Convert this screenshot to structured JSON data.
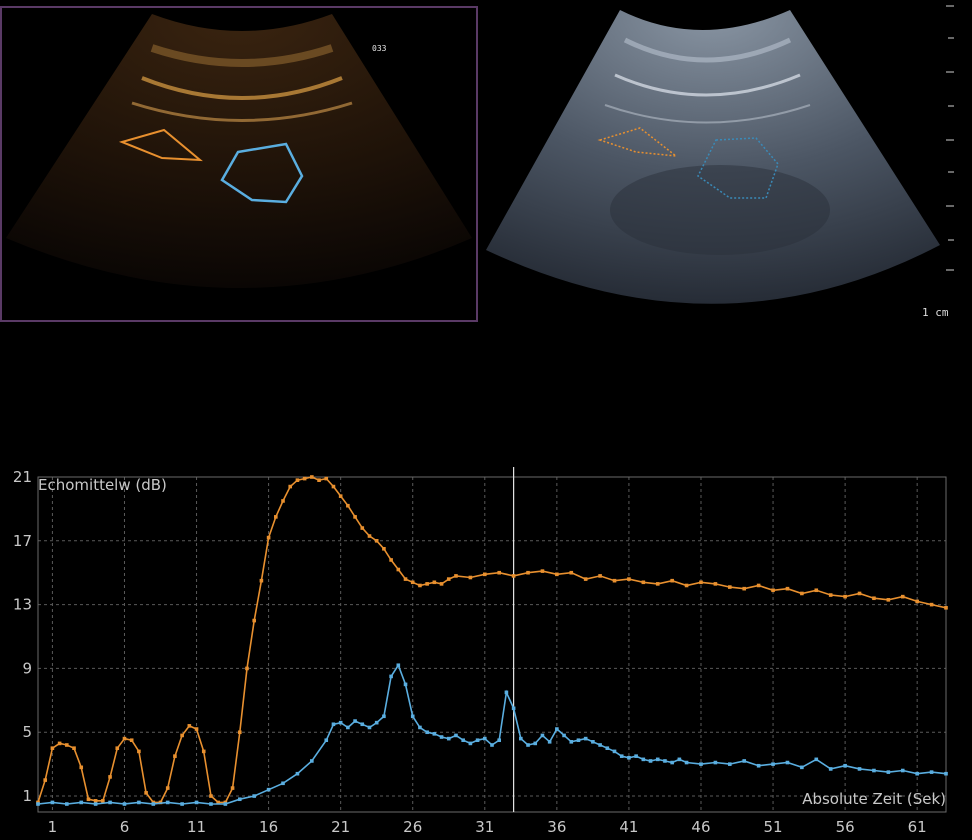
{
  "images": {
    "contrast_frame_label": "033",
    "scale_label": "1 cm"
  },
  "colors": {
    "orange": "#e8902f",
    "blue": "#5aaee0",
    "grid": "#5a5a5a",
    "text": "#c8c8c8"
  },
  "chart_data": {
    "type": "line",
    "ylabel": "Echomittelw (dB)",
    "xlabel": "Absolute Zeit (Sek)",
    "xlim": [
      0,
      63
    ],
    "ylim": [
      0,
      21
    ],
    "xticks": [
      1,
      6,
      11,
      16,
      21,
      26,
      31,
      36,
      41,
      46,
      51,
      56,
      61
    ],
    "yticks": [
      1,
      5,
      9,
      13,
      17,
      21
    ],
    "cursor_x": 33,
    "grid": true,
    "series": [
      {
        "color": "orange",
        "points": [
          [
            0,
            0.6
          ],
          [
            0.5,
            2
          ],
          [
            1,
            4
          ],
          [
            1.5,
            4.3
          ],
          [
            2,
            4.2
          ],
          [
            2.5,
            4
          ],
          [
            3,
            2.8
          ],
          [
            3.5,
            0.8
          ],
          [
            4,
            0.7
          ],
          [
            4.5,
            0.7
          ],
          [
            5,
            2.2
          ],
          [
            5.5,
            4
          ],
          [
            6,
            4.6
          ],
          [
            6.5,
            4.5
          ],
          [
            7,
            3.8
          ],
          [
            7.5,
            1.2
          ],
          [
            8,
            0.6
          ],
          [
            8.5,
            0.6
          ],
          [
            9,
            1.5
          ],
          [
            9.5,
            3.5
          ],
          [
            10,
            4.8
          ],
          [
            10.5,
            5.4
          ],
          [
            11,
            5.2
          ],
          [
            11.5,
            3.8
          ],
          [
            12,
            1
          ],
          [
            12.5,
            0.6
          ],
          [
            13,
            0.6
          ],
          [
            13.5,
            1.5
          ],
          [
            14,
            5
          ],
          [
            14.5,
            9
          ],
          [
            15,
            12
          ],
          [
            15.5,
            14.5
          ],
          [
            16,
            17.2
          ],
          [
            16.5,
            18.5
          ],
          [
            17,
            19.5
          ],
          [
            17.5,
            20.4
          ],
          [
            18,
            20.8
          ],
          [
            18.5,
            20.9
          ],
          [
            19,
            21
          ],
          [
            19.5,
            20.8
          ],
          [
            20,
            20.9
          ],
          [
            20.5,
            20.4
          ],
          [
            21,
            19.8
          ],
          [
            21.5,
            19.2
          ],
          [
            22,
            18.5
          ],
          [
            22.5,
            17.8
          ],
          [
            23,
            17.3
          ],
          [
            23.5,
            17
          ],
          [
            24,
            16.5
          ],
          [
            24.5,
            15.8
          ],
          [
            25,
            15.2
          ],
          [
            25.5,
            14.6
          ],
          [
            26,
            14.4
          ],
          [
            26.5,
            14.2
          ],
          [
            27,
            14.3
          ],
          [
            27.5,
            14.4
          ],
          [
            28,
            14.3
          ],
          [
            28.5,
            14.6
          ],
          [
            29,
            14.8
          ],
          [
            30,
            14.7
          ],
          [
            31,
            14.9
          ],
          [
            32,
            15
          ],
          [
            33,
            14.8
          ],
          [
            34,
            15
          ],
          [
            35,
            15.1
          ],
          [
            36,
            14.9
          ],
          [
            37,
            15
          ],
          [
            38,
            14.6
          ],
          [
            39,
            14.8
          ],
          [
            40,
            14.5
          ],
          [
            41,
            14.6
          ],
          [
            42,
            14.4
          ],
          [
            43,
            14.3
          ],
          [
            44,
            14.5
          ],
          [
            45,
            14.2
          ],
          [
            46,
            14.4
          ],
          [
            47,
            14.3
          ],
          [
            48,
            14.1
          ],
          [
            49,
            14
          ],
          [
            50,
            14.2
          ],
          [
            51,
            13.9
          ],
          [
            52,
            14
          ],
          [
            53,
            13.7
          ],
          [
            54,
            13.9
          ],
          [
            55,
            13.6
          ],
          [
            56,
            13.5
          ],
          [
            57,
            13.7
          ],
          [
            58,
            13.4
          ],
          [
            59,
            13.3
          ],
          [
            60,
            13.5
          ],
          [
            61,
            13.2
          ],
          [
            62,
            13
          ],
          [
            63,
            12.8
          ]
        ]
      },
      {
        "color": "blue",
        "points": [
          [
            0,
            0.5
          ],
          [
            1,
            0.6
          ],
          [
            2,
            0.5
          ],
          [
            3,
            0.6
          ],
          [
            4,
            0.5
          ],
          [
            5,
            0.6
          ],
          [
            6,
            0.5
          ],
          [
            7,
            0.6
          ],
          [
            8,
            0.5
          ],
          [
            9,
            0.6
          ],
          [
            10,
            0.5
          ],
          [
            11,
            0.6
          ],
          [
            12,
            0.5
          ],
          [
            13,
            0.5
          ],
          [
            14,
            0.8
          ],
          [
            15,
            1
          ],
          [
            16,
            1.4
          ],
          [
            17,
            1.8
          ],
          [
            18,
            2.4
          ],
          [
            19,
            3.2
          ],
          [
            20,
            4.5
          ],
          [
            20.5,
            5.5
          ],
          [
            21,
            5.6
          ],
          [
            21.5,
            5.3
          ],
          [
            22,
            5.7
          ],
          [
            22.5,
            5.5
          ],
          [
            23,
            5.3
          ],
          [
            23.5,
            5.6
          ],
          [
            24,
            6
          ],
          [
            24.5,
            8.5
          ],
          [
            25,
            9.2
          ],
          [
            25.5,
            8
          ],
          [
            26,
            6
          ],
          [
            26.5,
            5.3
          ],
          [
            27,
            5
          ],
          [
            27.5,
            4.9
          ],
          [
            28,
            4.7
          ],
          [
            28.5,
            4.6
          ],
          [
            29,
            4.8
          ],
          [
            29.5,
            4.5
          ],
          [
            30,
            4.3
          ],
          [
            30.5,
            4.5
          ],
          [
            31,
            4.6
          ],
          [
            31.5,
            4.2
          ],
          [
            32,
            4.5
          ],
          [
            32.5,
            7.5
          ],
          [
            33,
            6.5
          ],
          [
            33.5,
            4.6
          ],
          [
            34,
            4.2
          ],
          [
            34.5,
            4.3
          ],
          [
            35,
            4.8
          ],
          [
            35.5,
            4.4
          ],
          [
            36,
            5.2
          ],
          [
            36.5,
            4.8
          ],
          [
            37,
            4.4
          ],
          [
            37.5,
            4.5
          ],
          [
            38,
            4.6
          ],
          [
            38.5,
            4.4
          ],
          [
            39,
            4.2
          ],
          [
            39.5,
            4
          ],
          [
            40,
            3.8
          ],
          [
            40.5,
            3.5
          ],
          [
            41,
            3.4
          ],
          [
            41.5,
            3.5
          ],
          [
            42,
            3.3
          ],
          [
            42.5,
            3.2
          ],
          [
            43,
            3.3
          ],
          [
            43.5,
            3.2
          ],
          [
            44,
            3.1
          ],
          [
            44.5,
            3.3
          ],
          [
            45,
            3.1
          ],
          [
            46,
            3
          ],
          [
            47,
            3.1
          ],
          [
            48,
            3
          ],
          [
            49,
            3.2
          ],
          [
            50,
            2.9
          ],
          [
            51,
            3
          ],
          [
            52,
            3.1
          ],
          [
            53,
            2.8
          ],
          [
            54,
            3.3
          ],
          [
            55,
            2.7
          ],
          [
            56,
            2.9
          ],
          [
            57,
            2.7
          ],
          [
            58,
            2.6
          ],
          [
            59,
            2.5
          ],
          [
            60,
            2.6
          ],
          [
            61,
            2.4
          ],
          [
            62,
            2.5
          ],
          [
            63,
            2.4
          ]
        ]
      }
    ]
  }
}
